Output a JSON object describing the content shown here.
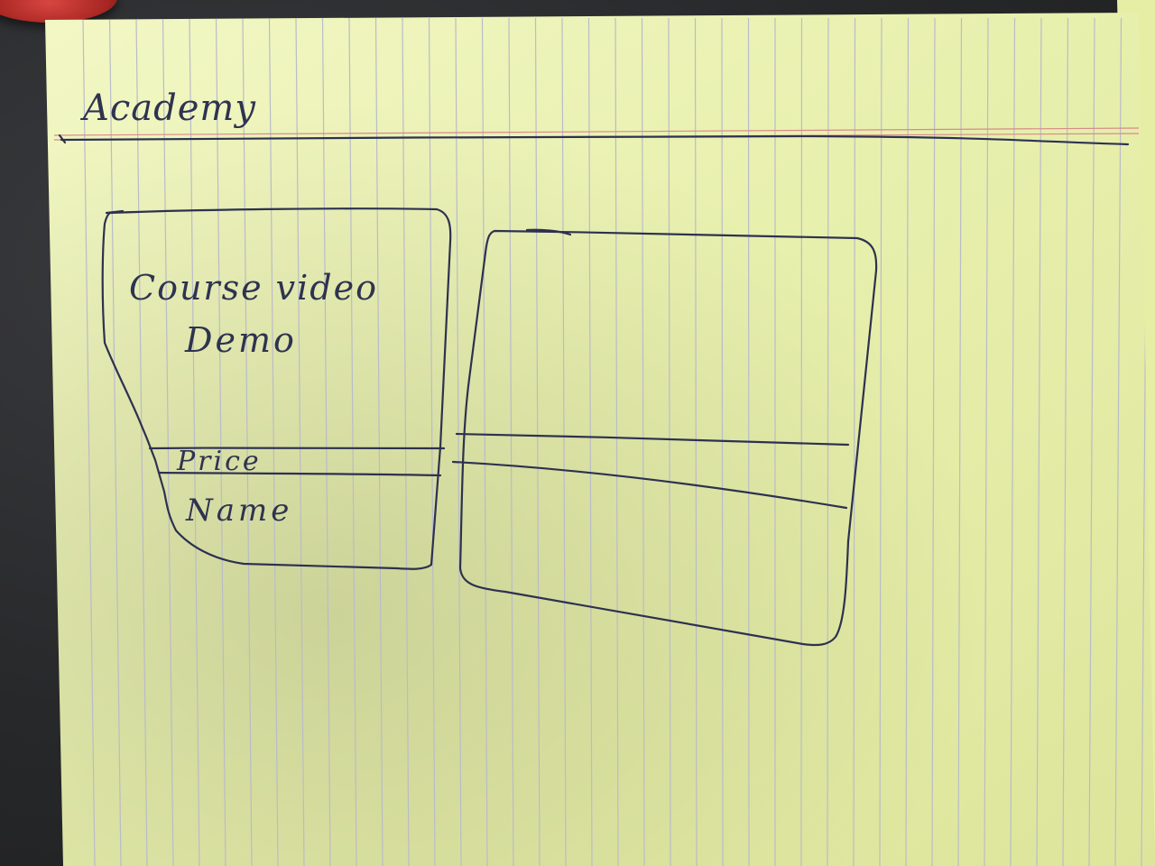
{
  "page": {
    "title": "Academy"
  },
  "cards": [
    {
      "media_line_1": "Course video",
      "media_line_2": "Demo",
      "price_label": "Price",
      "name_label": "Name"
    }
  ],
  "colors": {
    "paper": "#eef4b8",
    "ink": "#2d3150",
    "rule": "#b9bcc8",
    "margin": "#d88a8a"
  }
}
